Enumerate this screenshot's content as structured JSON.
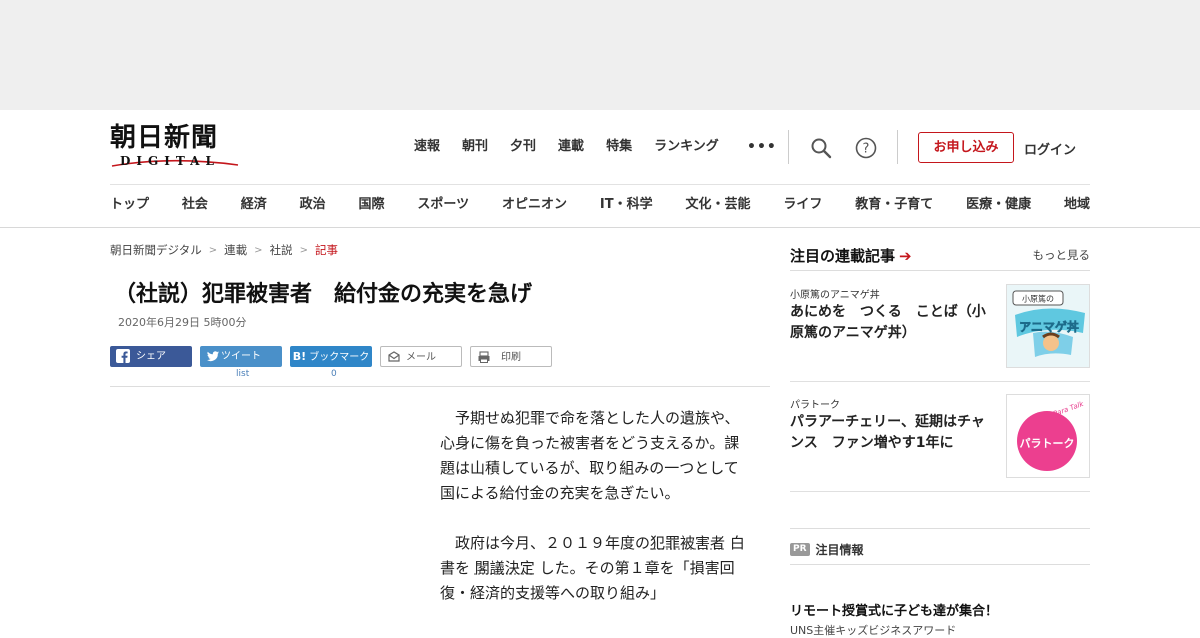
{
  "brand": {
    "name": "朝日新聞",
    "sub": "DIGITAL"
  },
  "topnav": [
    "速報",
    "朝刊",
    "夕刊",
    "連載",
    "特集",
    "ランキング"
  ],
  "header": {
    "more": "•••",
    "apply": "お申し込み",
    "login": "ログイン"
  },
  "categories": [
    "トップ",
    "社会",
    "経済",
    "政治",
    "国際",
    "スポーツ",
    "オピニオン",
    "IT・科学",
    "文化・芸能",
    "ライフ",
    "教育・子育て",
    "医療・健康",
    "地域"
  ],
  "breadcrumb": [
    "朝日新聞デジタル",
    "連載",
    "社説",
    "記事"
  ],
  "article": {
    "title": "（社説）犯罪被害者　給付金の充実を急げ",
    "date": "2020年6月29日 5時00分",
    "p1": "予期せぬ犯罪で命を落とした人の遺族や、心身に傷を負った被害者をどう支えるか。課題は山積しているが、取り組みの一つとして国による給付金の充実を急ぎたい。",
    "p2_a": "政府は今月、２０１９年度の",
    "p2_b": "犯罪被害者",
    "p2_c": "白書を",
    "p2_d": "閣議決定",
    "p2_e": "した。その第１章を「損害回復・経済的支援等への取り組み」"
  },
  "share": {
    "facebook": "シェア",
    "twitter": "ツイート",
    "twitter_count": "list",
    "hatena": "ブックマーク",
    "hatena_count": "0",
    "mail": "メール",
    "print": "印刷"
  },
  "sidebar": {
    "heading": "注目の連載記事",
    "more": "もっと見る",
    "items": [
      {
        "category": "小原篤のアニマゲ丼",
        "headline": "あにめを　つくる　ことば（小原篤のアニマゲ丼）",
        "thumb_label": "小原篤の",
        "thumb_art": "アニマゲ丼"
      },
      {
        "category": "パラトーク",
        "headline": "パラアーチェリー、延期はチャンス　ファン増やす1年に",
        "thumb_label": "Para Talk",
        "thumb_art": "パラトーク"
      }
    ],
    "pr_badge": "PR",
    "pr_label": "注目情報",
    "pr_title": "リモート授賞式に子ども達が集合！",
    "pr_sub": "UNS主催キッズビジネスアワード"
  },
  "colors": {
    "accent": "#c4161c",
    "facebook": "#3b5998",
    "twitter": "#4a90c9",
    "hatena": "#2f86c8"
  }
}
